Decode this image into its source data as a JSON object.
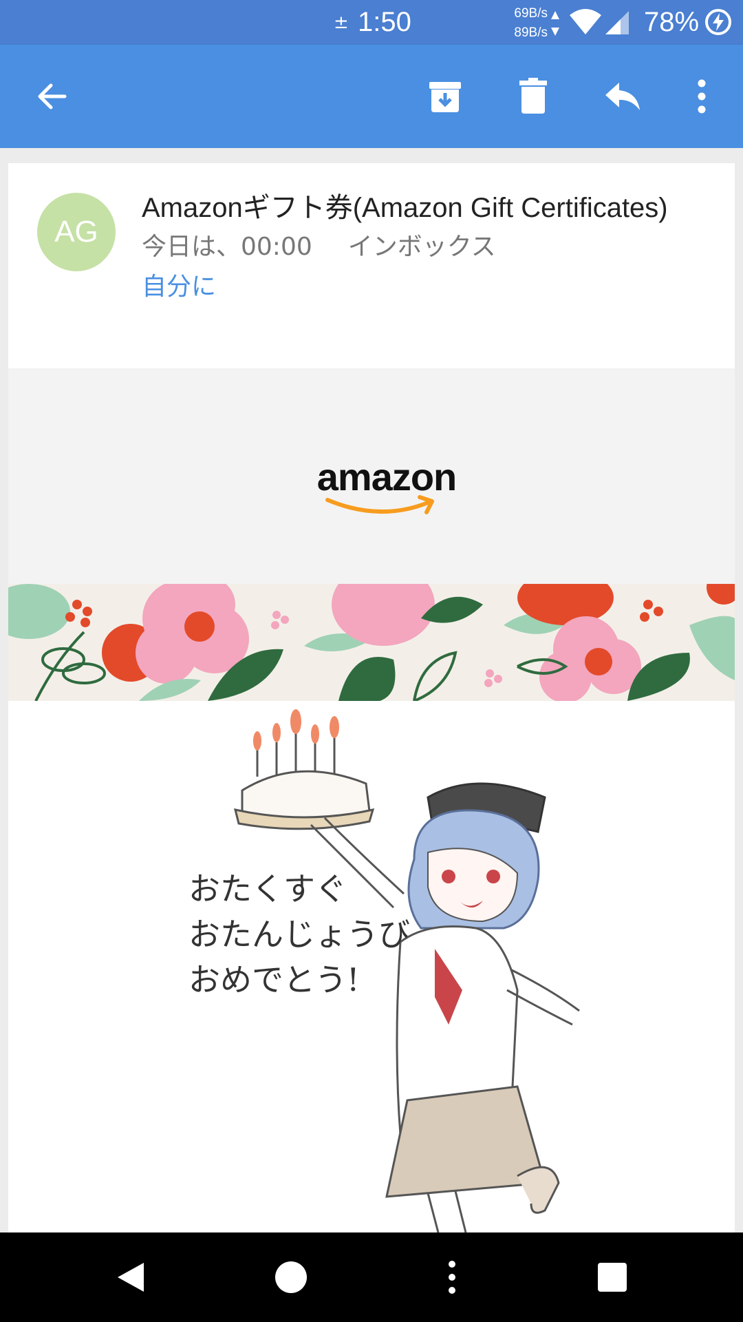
{
  "status_bar": {
    "time": "1:50",
    "net_up": "69B/s",
    "net_down": "89B/s",
    "battery": "78%",
    "icons": [
      "sync-icon",
      "wifi-icon",
      "signal-icon",
      "charging-icon"
    ]
  },
  "app_bar": {
    "actions": [
      "back",
      "archive",
      "delete",
      "reply",
      "more"
    ]
  },
  "email": {
    "avatar_initials": "AG",
    "avatar_color": "#c5e1a5",
    "sender": "Amazonギフト券(Amazon Gift Certificates)",
    "date": "今日は、00:00",
    "folder": "インボックス",
    "recipient": "自分に"
  },
  "body": {
    "logo_text": "amazon",
    "illustration_text": [
      "おたくすぐ",
      "おたんじょうび",
      "おめでとう!"
    ]
  },
  "colors": {
    "app_bar": "#4a8fe2",
    "status_bar": "#4a7fd1",
    "link": "#4a8fe2",
    "amazon_orange": "#f79c1f"
  }
}
